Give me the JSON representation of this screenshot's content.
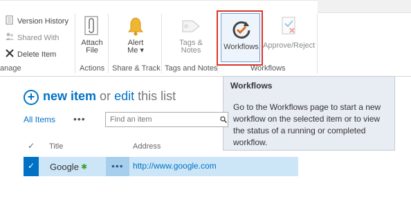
{
  "ribbon": {
    "manage_group": {
      "version_history": "Version History",
      "shared_with": "Shared With",
      "delete_item": "Delete Item",
      "label": "anage"
    },
    "actions_group": {
      "attach_line1": "Attach",
      "attach_line2": "File",
      "label": "Actions"
    },
    "share_track_group": {
      "alert_line1": "Alert",
      "alert_line2": "Me ▾",
      "label": "Share & Track"
    },
    "tags_notes_group": {
      "tags_line1": "Tags &",
      "tags_line2": "Notes",
      "label": "Tags and Notes"
    },
    "workflows_group": {
      "workflows": "Workflows",
      "approve_reject": "Approve/Reject",
      "label": "Workflows"
    }
  },
  "tooltip": {
    "title": "Workflows",
    "body": "Go to the Workflows page to start a new workflow on the selected item or to view the status of a running or completed workflow."
  },
  "list": {
    "new_item": "new item",
    "or": "or",
    "edit": "edit",
    "this_list": "this list",
    "view_tab": "All Items",
    "more": "•••",
    "search_placeholder": "Find an item",
    "columns": {
      "check": "✓",
      "title": "Title",
      "address": "Address"
    },
    "rows": [
      {
        "title": "Google",
        "new_marker": "✱",
        "menu": "•••",
        "address": "http://www.google.com"
      }
    ]
  },
  "colors": {
    "accent": "#0072c6",
    "highlight_border": "#d9342b",
    "selected_row": "#cde6f7"
  }
}
